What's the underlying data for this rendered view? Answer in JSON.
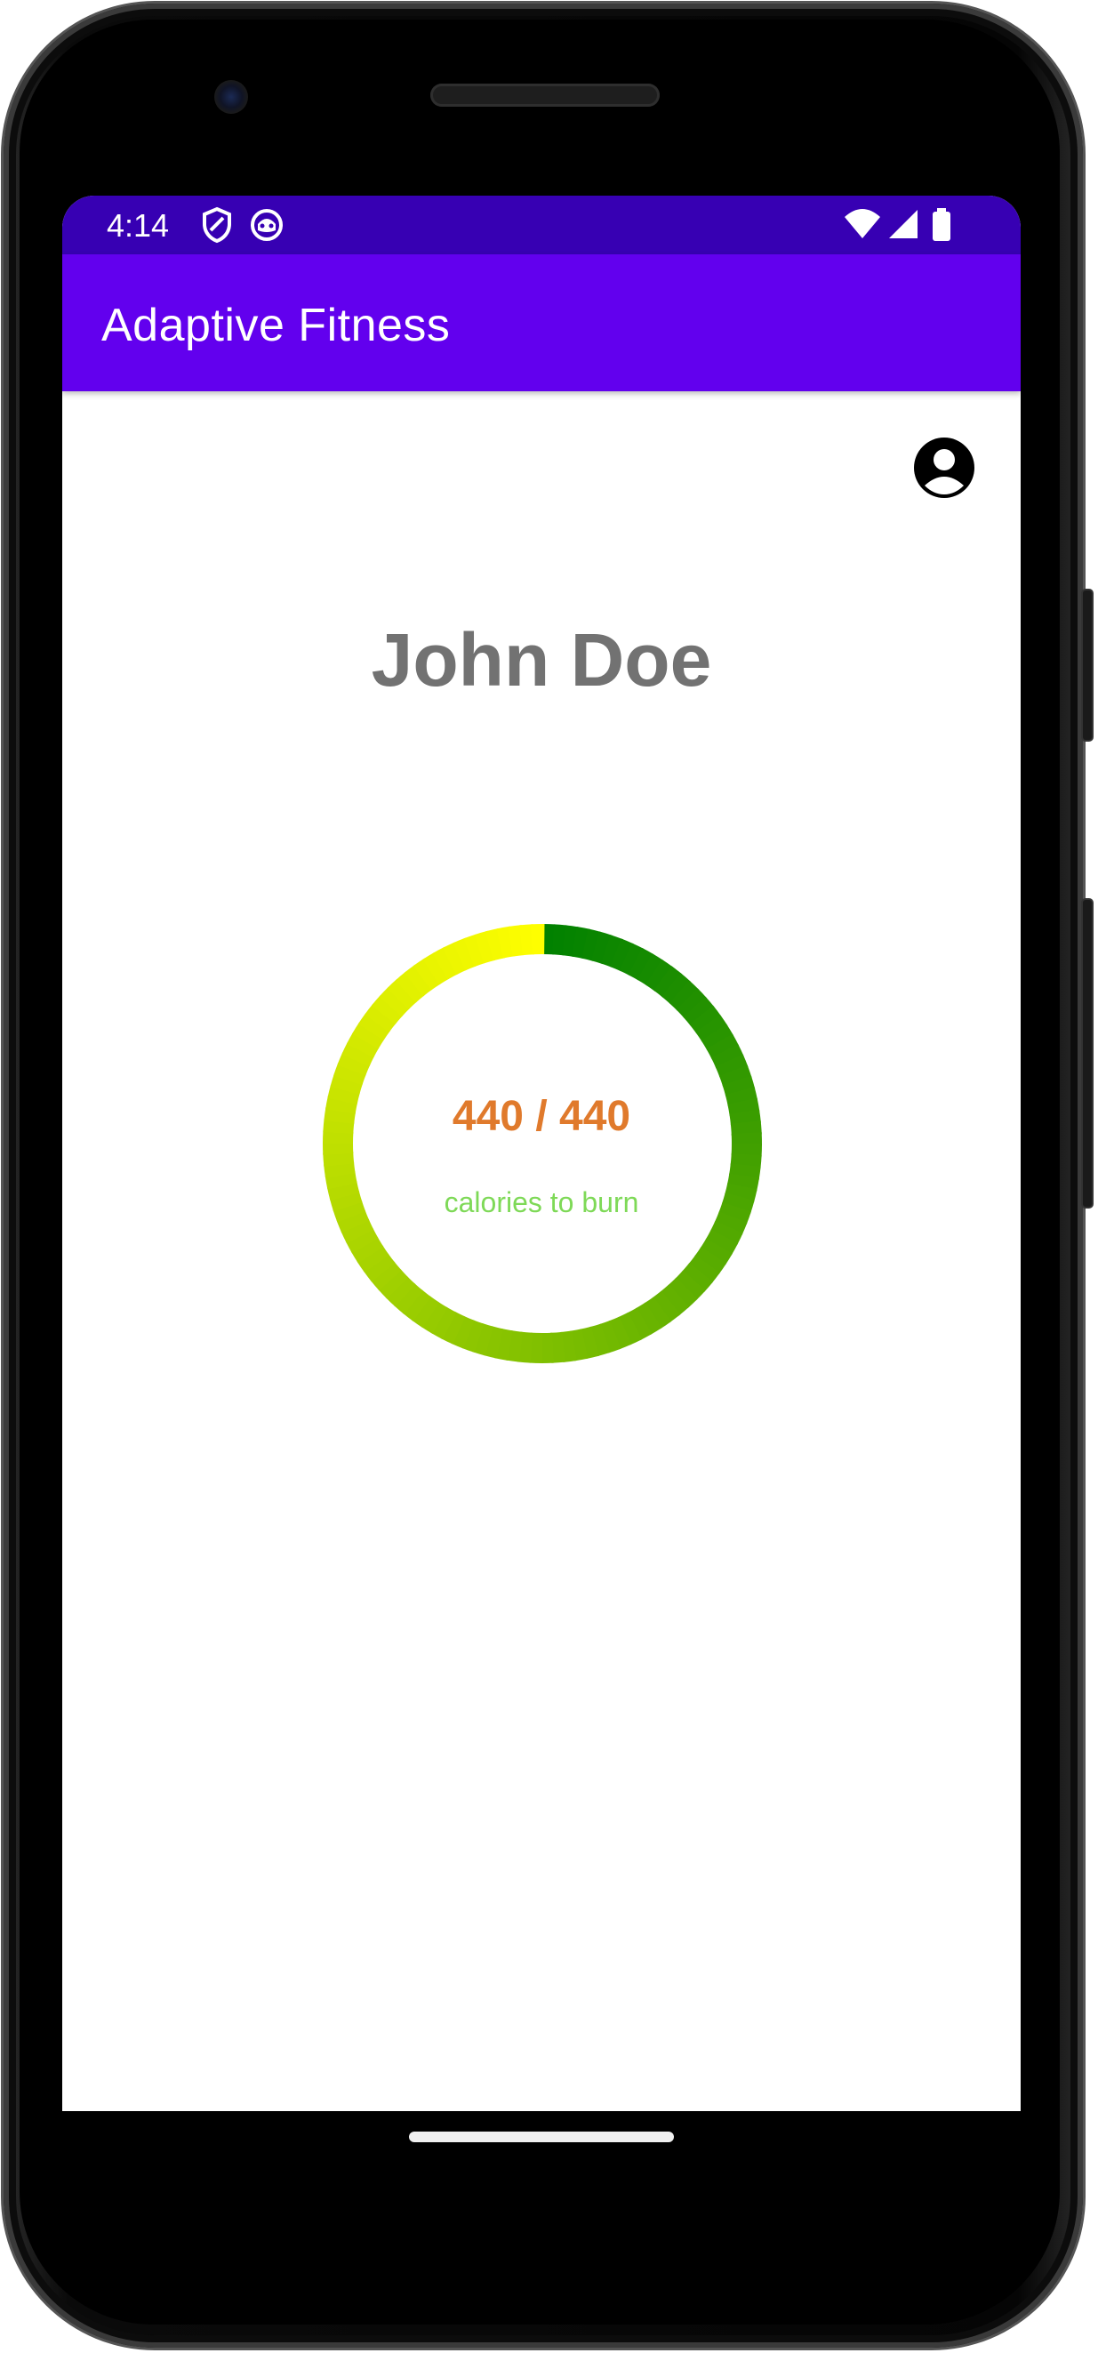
{
  "status_bar": {
    "time": "4:14",
    "background": "#3700b3",
    "left_icons": [
      "shield-icon",
      "notification-app-icon"
    ],
    "right_icons": [
      "wifi-icon",
      "cellular-signal-icon",
      "battery-icon"
    ]
  },
  "app_bar": {
    "title": "Adaptive Fitness",
    "background": "#6200ee"
  },
  "profile": {
    "icon": "account-circle-icon",
    "name": "John Doe"
  },
  "calories": {
    "burned": 440,
    "goal": 440,
    "display": "440 / 440",
    "label": "calories to burn",
    "progress_fraction": 1.0,
    "ring_gradient_start": "#ffff00",
    "ring_gradient_end": "#008000",
    "count_color": "#e07a2c",
    "label_color": "#7ed957"
  },
  "nav": {
    "home_indicator": "home-gesture-bar"
  }
}
